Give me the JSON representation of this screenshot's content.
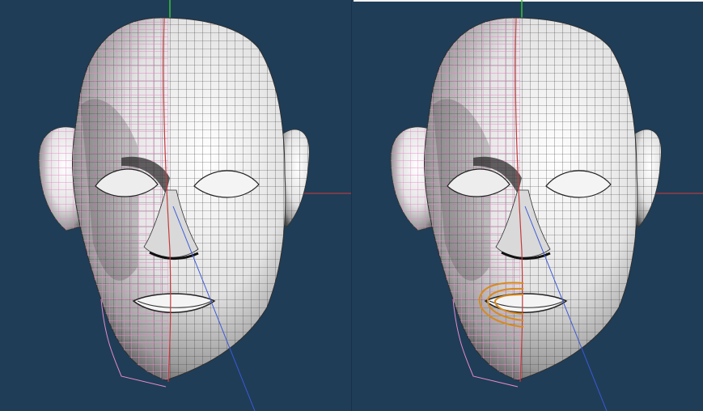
{
  "app": {
    "description_text": ""
  },
  "viewports": [
    {
      "id": "left",
      "selection_active": false
    },
    {
      "id": "right",
      "selection_active": true
    }
  ],
  "colors": {
    "background": "#1f3d57",
    "mesh_fill_light": "#f2f2f2",
    "mesh_fill_mid": "#bdbdbd",
    "mesh_fill_dark": "#5a5a5a",
    "mesh_lines": "#3a3a3a",
    "selection_wire": "#e68ac6",
    "axis_x": "#d23b3b",
    "axis_y": "#38c238",
    "axis_z": "#3c5ad8",
    "symmetry_line": "#c43b3b",
    "highlight_loop": "#d88a1e"
  },
  "icons": {
    "axis_gizmo": "axis-gizmo-icon"
  }
}
